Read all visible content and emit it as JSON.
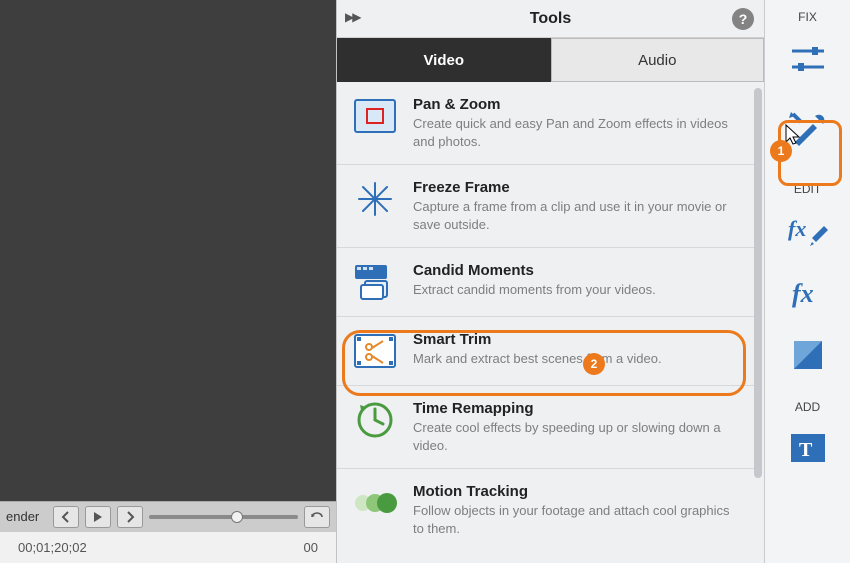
{
  "canvas": {
    "render_label": "ender",
    "timecode_left": "00;01;20;02",
    "timecode_right": "00"
  },
  "tools": {
    "title": "Tools",
    "tabs": {
      "video": "Video",
      "audio": "Audio"
    },
    "items": [
      {
        "title": "Pan & Zoom",
        "desc": "Create quick and easy Pan and Zoom effects in videos and photos."
      },
      {
        "title": "Freeze Frame",
        "desc": "Capture a frame from a clip and use it in your movie or save outside."
      },
      {
        "title": "Candid Moments",
        "desc": "Extract candid moments from your videos."
      },
      {
        "title": "Smart Trim",
        "desc": "Mark and extract best scenes from a video."
      },
      {
        "title": "Time Remapping",
        "desc": "Create cool effects by speeding up or slowing down a video."
      },
      {
        "title": "Motion Tracking",
        "desc": "Follow objects in your footage and attach cool graphics to them."
      }
    ]
  },
  "rail": {
    "fix": "FIX",
    "edit": "EDIT",
    "add": "ADD"
  },
  "callouts": {
    "one": "1",
    "two": "2"
  }
}
